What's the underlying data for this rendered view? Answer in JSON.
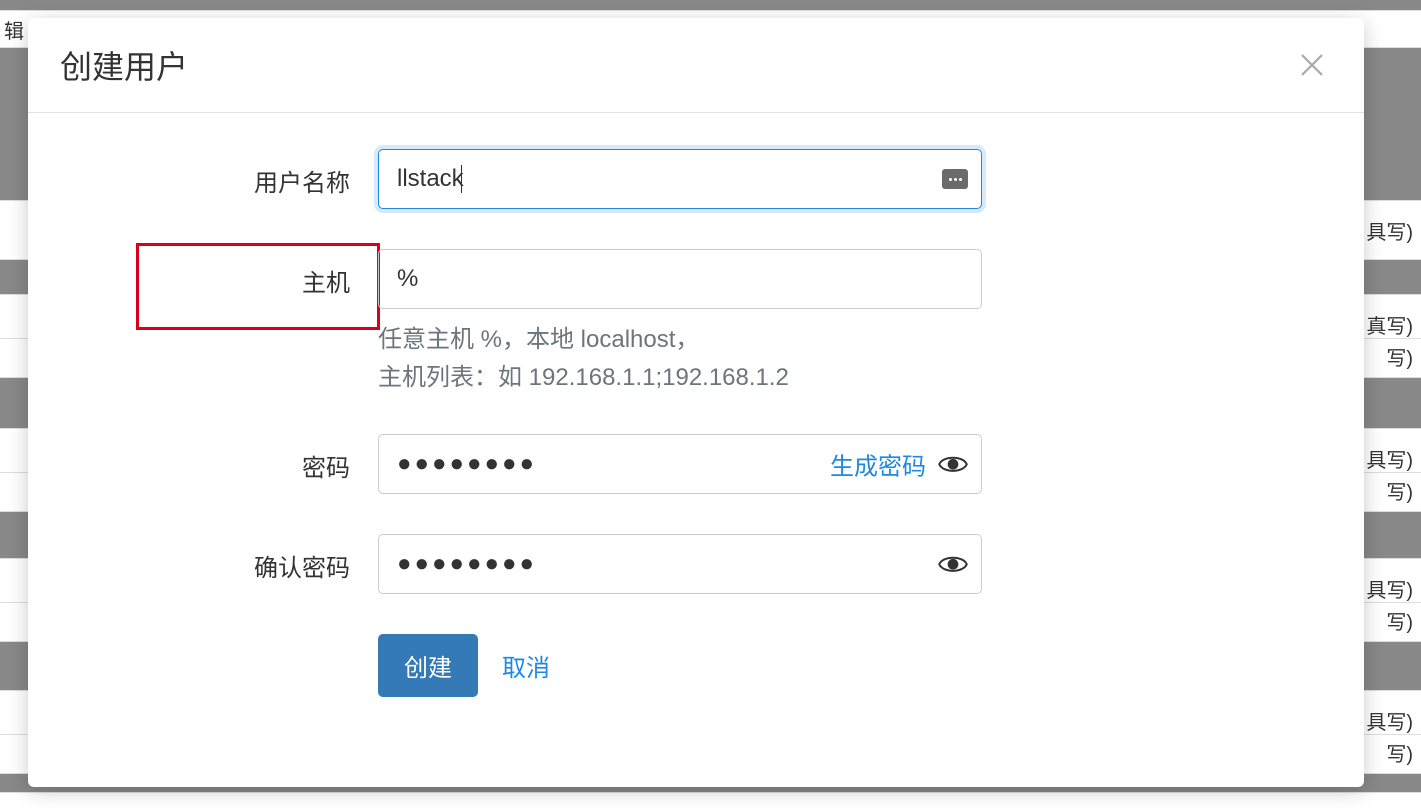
{
  "modal": {
    "title": "创建用户",
    "username_label": "用户名称",
    "username_value": "llstack",
    "host_label": "主机",
    "host_value": "%",
    "host_hint_line1": "任意主机 %，本地 localhost，",
    "host_hint_line2": "主机列表：如 192.168.1.1;192.168.1.2",
    "password_label": "密码",
    "password_value": "●●●●●●●●",
    "generate_password_label": "生成密码",
    "confirm_password_label": "确认密码",
    "confirm_password_value": "●●●●●●●●",
    "create_button": "创建",
    "cancel_button": "取消"
  },
  "background": {
    "edit_label": "辑",
    "fill_label1": "具写)",
    "fill_label2": "真写)",
    "fill_label3": "写)"
  }
}
